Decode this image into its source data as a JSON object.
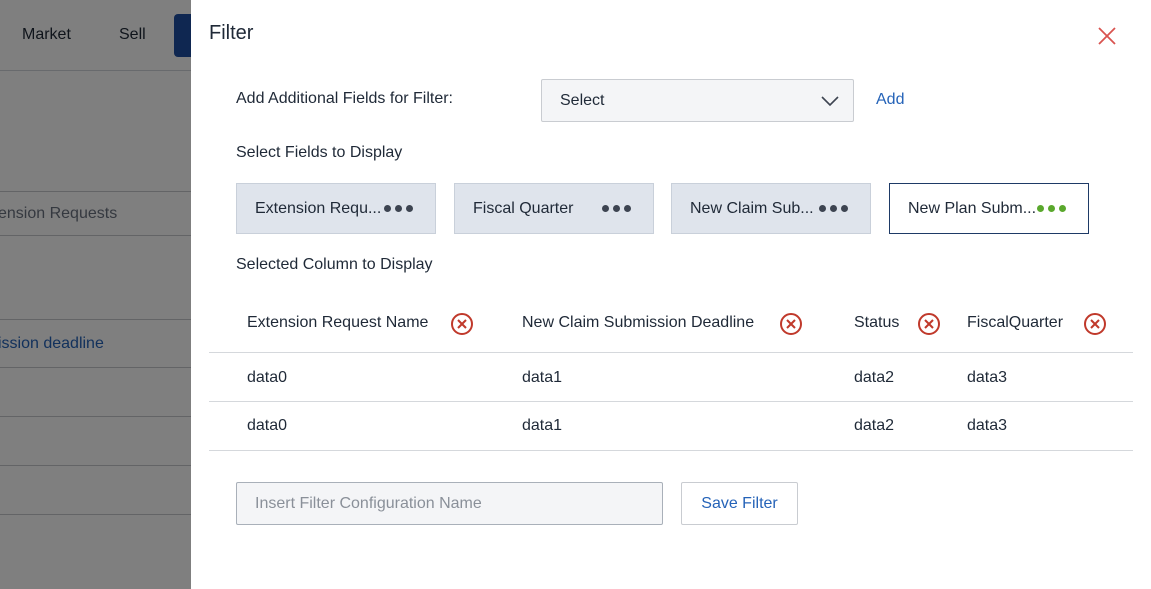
{
  "background": {
    "nav": {
      "market_label": "Market",
      "sell_label": "Sell"
    },
    "row_text_1": "ension Requests",
    "row_text_2": "ission deadline"
  },
  "drawer": {
    "title": "Filter",
    "add_fields_label": "Add Additional Fields for Filter:",
    "select_value": "Select",
    "add_link": "Add",
    "select_fields_label": "Select Fields to Display",
    "chips": [
      {
        "label": "Extension Requ..."
      },
      {
        "label": "Fiscal Quarter"
      },
      {
        "label": "New Claim Sub..."
      },
      {
        "label": "New Plan Subm..."
      }
    ],
    "selected_columns_label": "Selected Column to Display",
    "table": {
      "headers": [
        "Extension Request Name",
        "New Claim Submission Deadline",
        "Status",
        "FiscalQuarter"
      ],
      "rows": [
        [
          "data0",
          "data1",
          "data2",
          "data3"
        ],
        [
          "data0",
          "data1",
          "data2",
          "data3"
        ]
      ]
    },
    "config_name_placeholder": "Insert Filter Configuration Name",
    "save_label": "Save Filter"
  },
  "colors": {
    "accent": "#2563b8",
    "nav_blue": "#1e4fa3",
    "remove_red": "#c0392b",
    "active_dots": "#5aa82d"
  },
  "icons": {
    "close": "close-icon",
    "dropdown": "chevron-down-icon",
    "remove": "remove-circle-icon",
    "more": "more-dots-icon"
  }
}
